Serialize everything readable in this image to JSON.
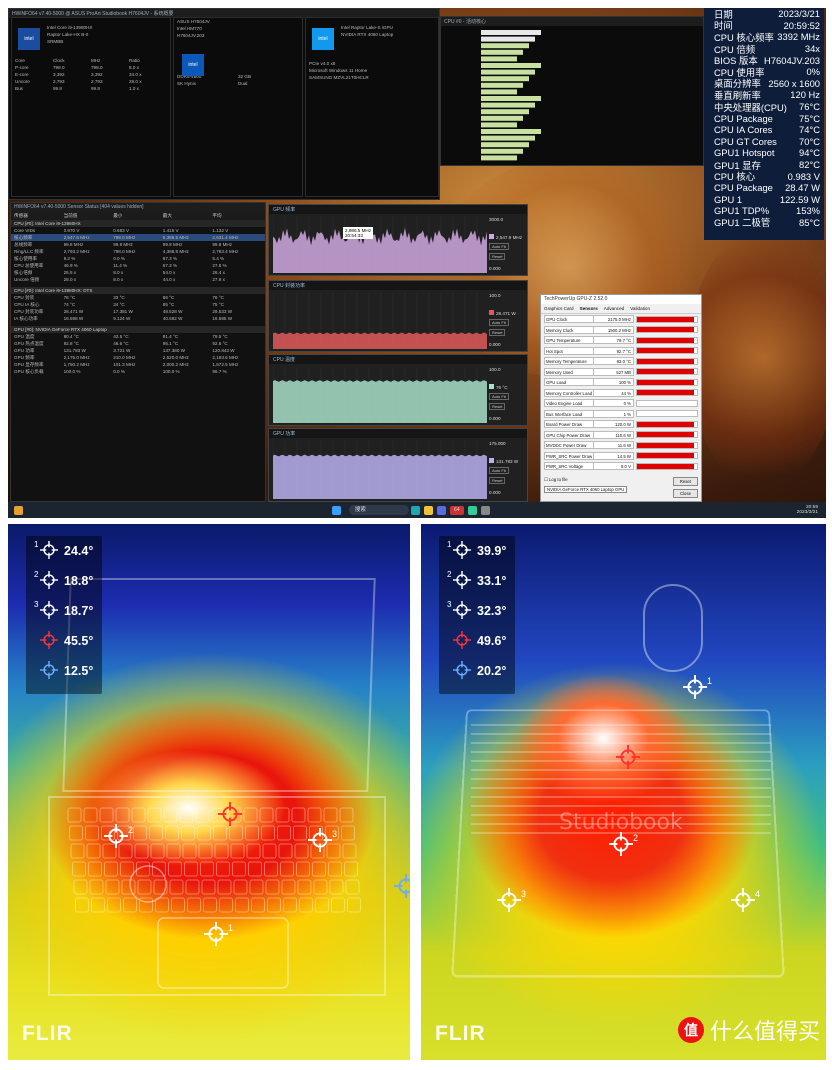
{
  "osd": {
    "rows": [
      {
        "label": "日期",
        "value": "2023/3/21"
      },
      {
        "label": "时间",
        "value": "20:59:52"
      },
      {
        "label": "CPU 核心频率",
        "value": "3392 MHz"
      },
      {
        "label": "CPU 倍频",
        "value": "34x"
      },
      {
        "label": "BIOS 版本",
        "value": "H7604JV.203"
      },
      {
        "label": "CPU 使用率",
        "value": "0%"
      },
      {
        "label": "桌面分辨率",
        "value": "2560 x 1600"
      },
      {
        "label": "垂直刷新率",
        "value": "120 Hz"
      },
      {
        "label": "中央处理器(CPU)",
        "value": "76°C"
      },
      {
        "label": "CPU Package",
        "value": "75°C"
      },
      {
        "label": "CPU IA Cores",
        "value": "74°C"
      },
      {
        "label": "CPU GT Cores",
        "value": "70°C"
      },
      {
        "label": "GPU1 Hotspot",
        "value": "94°C"
      },
      {
        "label": "GPU1 显存",
        "value": "82°C"
      },
      {
        "label": "CPU 核心",
        "value": "0.983 V"
      },
      {
        "label": "CPU Package",
        "value": "28.47 W"
      },
      {
        "label": "GPU 1",
        "value": "122.59 W"
      },
      {
        "label": "GPU1 TDP%",
        "value": "153%"
      },
      {
        "label": "GPU1 二极管",
        "value": "85°C"
      }
    ],
    "colors": {
      "bg": "#0e1d3a",
      "label": "#ffffff",
      "value": "#ffffff"
    }
  },
  "gpuz": {
    "title": "TechPowerUp GPU-Z 2.52.0",
    "tabs": [
      "Graphics Card",
      "Sensors",
      "Advanced",
      "Validation"
    ],
    "rows": [
      {
        "label": "GPU Clock",
        "value": "2175.0 MHz",
        "fill": 0.95
      },
      {
        "label": "Memory Clock",
        "value": "1500.2 MHz",
        "fill": 0.95
      },
      {
        "label": "GPU Temperature",
        "value": "79.7 °C",
        "fill": 0.95
      },
      {
        "label": "Hot Spot",
        "value": "92.7 °C",
        "fill": 0.95
      },
      {
        "label": "Memory Temperature",
        "value": "83.0 °C",
        "fill": 0.95
      },
      {
        "label": "Memory Used",
        "value": "527 MB",
        "fill": 0.95
      },
      {
        "label": "GPU Load",
        "value": "100 %",
        "fill": 0.95
      },
      {
        "label": "Memory Controller Load",
        "value": "44 %",
        "fill": 0.95
      },
      {
        "label": "Video Engine Load",
        "value": "0 %",
        "fill": 0
      },
      {
        "label": "Bus Interface Load",
        "value": "1 %",
        "fill": 0
      },
      {
        "label": "Board Power Draw",
        "value": "120.0 W",
        "fill": 0.95
      },
      {
        "label": "GPU Chip Power Draw",
        "value": "110.6 W",
        "fill": 0.95
      },
      {
        "label": "MVDDC Power Draw",
        "value": "11.6 W",
        "fill": 0.95
      },
      {
        "label": "PWR_SRC Power Draw",
        "value": "14.5 W",
        "fill": 0.95
      },
      {
        "label": "PWR_SRC Voltage",
        "value": "9.0 V",
        "fill": 0.95
      }
    ],
    "log": "Log to file",
    "reset": "Reset",
    "device": "NVIDIA GeForce RTX 4060 Laptop GPU",
    "close": "Close"
  },
  "hwinfo": {
    "title": "HWiNFO64 v7.40-5000 Sensor Status [404 values hidden]",
    "headers": [
      "传感器",
      "当前值",
      "最小",
      "最大",
      "平均"
    ],
    "sections": [
      {
        "name": "CPU [#0]: Intel Core i9-13980HX",
        "rows": [
          [
            "Core VIDs",
            "0.970 V",
            "0.683 V",
            "1.415 V",
            "1.132 V"
          ],
          [
            "核心频率",
            "2,547.6 MHz",
            "798.0 MHz",
            "5,386.5 MHz",
            "2,631.4 MHz"
          ],
          [
            "总线频率",
            "99.8 MHz",
            "99.8 MHz",
            "99.8 MHz",
            "99.8 MHz"
          ],
          [
            "Ring/LLC 频率",
            "2,793.2 MHz",
            "798.0 MHz",
            "4,388.8 MHz",
            "2,783.4 MHz"
          ],
          [
            "核心使用率",
            "9.2 %",
            "0.0 %",
            "87.3 %",
            "5.4 %"
          ],
          [
            "CPU 总使用率",
            "46.9 %",
            "11.4 %",
            "67.3 %",
            "27.6 %"
          ],
          [
            "核心倍频",
            "25.5 x",
            "8.0 x",
            "54.0 x",
            "26.4 x"
          ],
          [
            "Uncore 倍频",
            "28.0 x",
            "8.0 x",
            "44.0 x",
            "27.9 x"
          ]
        ]
      },
      {
        "name": "CPU [#0]: Intel Core i9-13980HX: DTS",
        "rows": [
          [
            "CPU 封装",
            "76 °C",
            "33 °C",
            "86 °C",
            "76 °C"
          ],
          [
            "CPU IA 核心",
            "74 °C",
            "34 °C",
            "85 °C",
            "75 °C"
          ],
          [
            "CPU 封装功率",
            "28.471 W",
            "17.381 W",
            "48.528 W",
            "29.533 W"
          ],
          [
            "IA 核心功率",
            "16.598 W",
            "9.124 W",
            "40.582 W",
            "16.585 W"
          ]
        ]
      },
      {
        "name": "GPU [#0]: NVIDIA GeForce RTX 4060 Laptop",
        "rows": [
          [
            "GPU 温度",
            "80.4 °C",
            "42.5 °C",
            "81.4 °C",
            "79.5 °C"
          ],
          [
            "GPU 热点温度",
            "92.8 °C",
            "46.6 °C",
            "95.1 °C",
            "92.6 °C"
          ],
          [
            "GPU 功率",
            "131.783 W",
            "3.721 W",
            "137.380 W",
            "120.843 W"
          ],
          [
            "GPU 频率",
            "2,175.0 MHz",
            "210.0 MHz",
            "2,520.0 MHz",
            "2,193.6 MHz"
          ],
          [
            "GPU 显存频率",
            "1,750.2 MHz",
            "101.3 MHz",
            "2,000.2 MHz",
            "1,572.5 MHz"
          ],
          [
            "GPU 核心负载",
            "100.0 %",
            "0.0 %",
            "100.0 %",
            "96.7 %"
          ]
        ]
      }
    ]
  },
  "graphs": [
    {
      "title": "GPU 频率",
      "max": "3000.0",
      "value": "2,547.9 MHz",
      "tooltip": "2,986.5 MHz\n20:54:33",
      "min": "0.000",
      "color": "#d0a8e0"
    },
    {
      "title": "CPU 封装功率",
      "max": "100.0",
      "value": "28.471 W",
      "min": "0.000",
      "color": "#e05a5a"
    },
    {
      "title": "CPU 温度",
      "max": "100.0",
      "value": "76 °C",
      "min": "0.000",
      "color": "#a8e0c8"
    },
    {
      "title": "GPU 功率",
      "max": "175.000",
      "value": "131.783 W",
      "min": "0.000",
      "color": "#b8b0f0"
    }
  ],
  "taskbar": {
    "search": "搜索",
    "time": "20:59",
    "date": "2023/3/21",
    "badge": "64"
  },
  "thermal_left": {
    "readings": [
      {
        "index": "1",
        "value": "24.4°",
        "color": "#ffffff"
      },
      {
        "index": "2",
        "value": "18.8°",
        "color": "#ffffff"
      },
      {
        "index": "3",
        "value": "18.7°",
        "color": "#ffffff"
      },
      {
        "index": "",
        "value": "45.5°",
        "color": "#ff3333"
      },
      {
        "index": "",
        "value": "12.5°",
        "color": "#6aaaff"
      }
    ],
    "brand": "FLIR"
  },
  "thermal_right": {
    "readings": [
      {
        "index": "1",
        "value": "39.9°",
        "color": "#ffffff"
      },
      {
        "index": "2",
        "value": "33.1°",
        "color": "#ffffff"
      },
      {
        "index": "3",
        "value": "32.3°",
        "color": "#ffffff"
      },
      {
        "index": "",
        "value": "49.6°",
        "color": "#ff3333"
      },
      {
        "index": "",
        "value": "20.2°",
        "color": "#6aaaff"
      }
    ],
    "brand": "FLIR",
    "lid_text": "Studiobook",
    "watermark": "什么值得买",
    "watermark_badge": "值"
  }
}
